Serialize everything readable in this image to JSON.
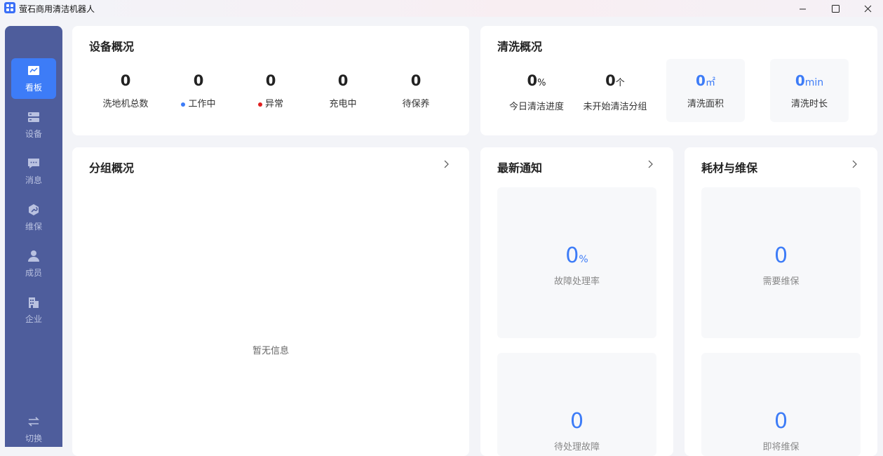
{
  "window": {
    "title": "萤石商用清洁机器人"
  },
  "sidebar": {
    "items": [
      {
        "label": "看板",
        "icon": "chart-icon"
      },
      {
        "label": "设备",
        "icon": "device-icon"
      },
      {
        "label": "消息",
        "icon": "message-icon"
      },
      {
        "label": "维保",
        "icon": "wrench-icon"
      },
      {
        "label": "成员",
        "icon": "user-icon"
      },
      {
        "label": "企业",
        "icon": "building-icon"
      }
    ],
    "switch_label": "切换"
  },
  "device_overview": {
    "title": "设备概况",
    "stats": [
      {
        "value": "0",
        "label": "洗地机总数"
      },
      {
        "value": "0",
        "label": "工作中",
        "dot": "#3d7cf7"
      },
      {
        "value": "0",
        "label": "异常",
        "dot": "#e02020"
      },
      {
        "value": "0",
        "label": "充电中"
      },
      {
        "value": "0",
        "label": "待保养"
      }
    ]
  },
  "wash_overview": {
    "title": "清洗概况",
    "progress": {
      "value": "0",
      "unit": "%",
      "label": "今日清洁进度"
    },
    "not_started": {
      "value": "0",
      "unit": "个",
      "label": "未开始清洁分组"
    },
    "area": {
      "value": "0",
      "unit": "㎡",
      "label": "清洗面积"
    },
    "duration": {
      "value": "0",
      "unit": "min",
      "label": "清洗时长"
    }
  },
  "group_overview": {
    "title": "分组概况",
    "empty_text": "暂无信息"
  },
  "notices": {
    "title": "最新通知",
    "fault_rate": {
      "value": "0",
      "unit": "%",
      "label": "故障处理率"
    },
    "pending": {
      "value": "0",
      "label": "待处理故障"
    }
  },
  "consumables": {
    "title": "耗材与维保",
    "need_maintenance": {
      "value": "0",
      "label": "需要维保"
    },
    "expiring": {
      "value": "0",
      "label": "即将维保"
    }
  },
  "colors": {
    "accent": "#3d7cf7",
    "sidebar": "#4e5d9c",
    "error": "#e02020"
  }
}
